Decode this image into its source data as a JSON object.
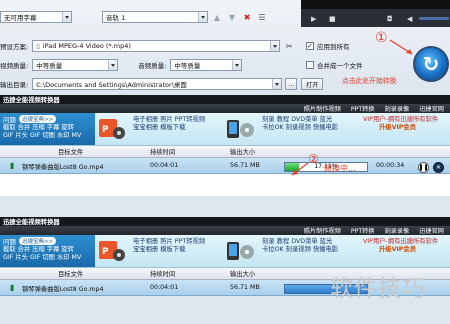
{
  "settings": {
    "subtitle_value": "无可用字幕",
    "audio_track_value": "音轨 1",
    "preset_label": "预设方案:",
    "preset_value": "iPad MPEG-4 Video (*.mp4)",
    "video_quality_label": "视频质量:",
    "video_quality_value": "中等质量",
    "audio_quality_label": "音频质量:",
    "audio_quality_value": "中等质量",
    "apply_all_label": "应用到所有",
    "merge_label": "合并成一个文件",
    "output_dir_label": "输出目录:",
    "output_dir_value": "C:\\Documents and Settings\\Administrator\\桌面",
    "open_folder_label": "打开"
  },
  "annotations": {
    "step1_num": "①",
    "step1_text": "点击此处开始转换",
    "step2_num": "②",
    "step2_text": "转换中..."
  },
  "windows": [
    {
      "title": "迅捷全能视频转换器",
      "menu": [
        "照片制作视频",
        "PPT转换",
        "刻录录像",
        "迅捷官网"
      ],
      "banner": {
        "left_title": "问题",
        "left_pill": "迅捷宝典>>",
        "left_line1": "截取 合并 压缩 字幕 旋转",
        "left_line2": "GIF 片头 GIF 切图 水印 MV",
        "mid1_line1": "电子相册  照片  PPT转视频",
        "mid1_line2": "宝宝相册  模板下载",
        "mid2_line1": "刻录  教程  DVD菜单  蓝光",
        "mid2_line2": "卡拉OK  刻录视频  快播电影",
        "vip_line1": "VIP用户-拥有迅捷所有软件",
        "vip_line2": "升级VIP会员"
      },
      "columns": [
        "目标文件",
        "持续时间",
        "输出大小"
      ],
      "row": {
        "file": "钢琴弹奏曲版Lost8 Go.mp4",
        "duration": "00:04:01",
        "size": "56.71 MB",
        "progress_text": "17.11%",
        "progress_fraction": 0.1711,
        "elapsed": "00:00:34"
      }
    },
    {
      "title": "迅捷全能视频转换器",
      "menu": [
        "照片制作视频",
        "PPT转换",
        "刻录录像",
        "迅捷官网"
      ],
      "banner": {
        "left_title": "问题",
        "left_pill": "迅捷宝典>>",
        "left_line1": "截取 合并 压缩 字幕 旋转",
        "left_line2": "GIF 片头 GIF 切图 水印 MV",
        "mid1_line1": "电子相册  照片  PPT转视频",
        "mid1_line2": "宝宝相册  模板下载",
        "mid2_line1": "刻录  教程  DVD菜单  蓝光",
        "mid2_line2": "卡拉OK  刻录视频  快播电影",
        "vip_line1": "VIP用户-拥有迅捷所有软件",
        "vip_line2": "升级VIP会员"
      },
      "columns": [
        "目标文件",
        "持续时间",
        "输出大小"
      ],
      "row": {
        "file": "钢琴弹奏曲版Lost8 Go.mp4",
        "duration": "00:04:01",
        "size": "56.71 MB"
      }
    }
  ],
  "watermark": "软件技巧",
  "colors": {
    "accent": "#1a6fc4",
    "annotation": "#e73c2a",
    "progress": "#1ca332",
    "vip": "#c12828"
  },
  "icons": [
    "up-arrow-icon",
    "down-arrow-icon",
    "delete-icon",
    "list-icon",
    "wrench-icon",
    "play-icon",
    "stop-icon",
    "camera-icon",
    "volume-icon",
    "convert-icon",
    "pause-icon",
    "close-icon",
    "file-icon"
  ]
}
